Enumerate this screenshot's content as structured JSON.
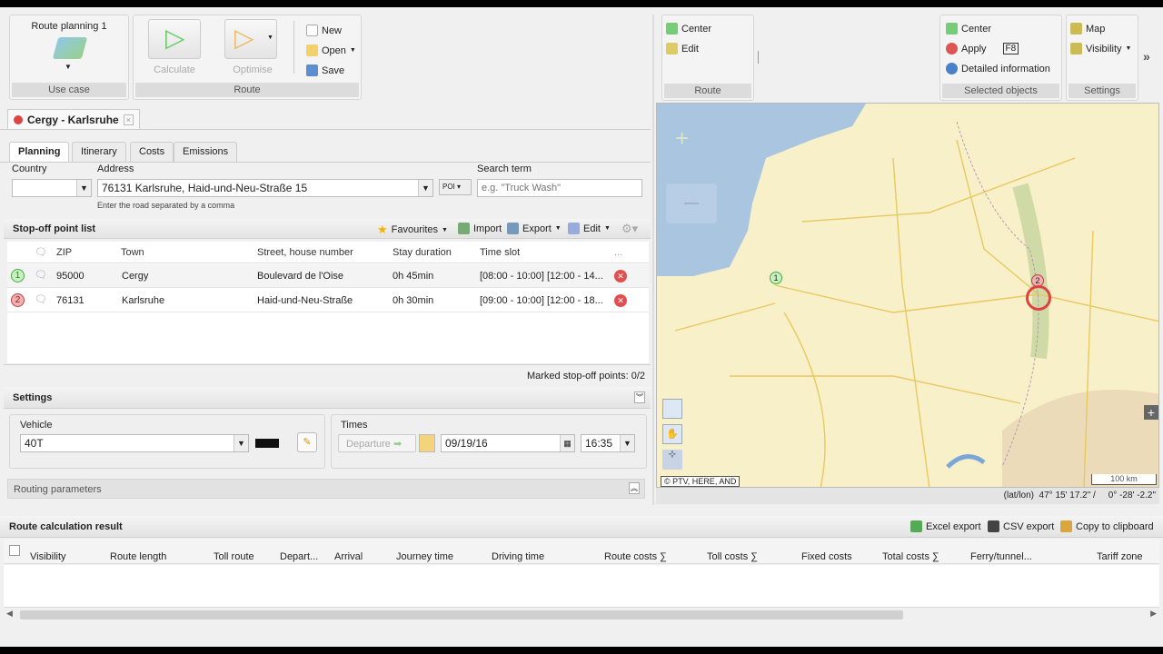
{
  "ribbon": {
    "use_case": {
      "title": "Route planning 1",
      "caption": "Use case"
    },
    "route": {
      "calculate": "Calculate",
      "optimise": "Optimise",
      "new": "New",
      "open": "Open",
      "save": "Save",
      "caption": "Route"
    },
    "map_route": {
      "center": "Center",
      "edit": "Edit",
      "caption": "Route"
    },
    "selected": {
      "center": "Center",
      "apply": "Apply",
      "shortcut": "F8",
      "details": "Detailed information",
      "caption": "Selected objects"
    },
    "settings": {
      "map": "Map",
      "visibility": "Visibility",
      "caption": "Settings",
      "more": "»"
    }
  },
  "doc_tab": {
    "title": "Cergy - Karlsruhe"
  },
  "tabs": [
    {
      "label": "Planning",
      "active": true
    },
    {
      "label": "Itinerary"
    },
    {
      "label": "Costs"
    },
    {
      "label": "Emissions"
    }
  ],
  "address_form": {
    "country_label": "Country",
    "country_value": "",
    "address_label": "Address",
    "address_value": "76131 Karlsruhe, Haid-und-Neu-Straße 15",
    "hint": "Enter the road separated by a comma",
    "poi": "POI",
    "search_label": "Search term",
    "search_placeholder": "e.g. \"Truck Wash\""
  },
  "stoplist": {
    "title": "Stop-off point list",
    "favourites": "Favourites",
    "import": "Import",
    "export": "Export",
    "edit": "Edit",
    "columns": [
      "ZIP",
      "Town",
      "Street, house number",
      "Stay duration",
      "Time slot",
      "..."
    ],
    "rows": [
      {
        "n": "1",
        "zip": "95000",
        "town": "Cergy",
        "street": "Boulevard de l'Oise",
        "stay": "0h 45min",
        "slot": "[08:00 - 10:00] [12:00 - 14..."
      },
      {
        "n": "2",
        "zip": "76131",
        "town": "Karlsruhe",
        "street": "Haid-und-Neu-Straße",
        "stay": "0h 30min",
        "slot": "[09:00 - 10:00] [12:00 - 18..."
      }
    ],
    "marked": "Marked stop-off points: 0/2"
  },
  "settings": {
    "title": "Settings",
    "vehicle_label": "Vehicle",
    "vehicle": "40T",
    "times_label": "Times",
    "departure": "Departure",
    "date": "09/19/16",
    "time": "16:35",
    "routing": "Routing parameters"
  },
  "map": {
    "copyright": "© PTV, HERE, AND",
    "scale": "100 km",
    "coords": "(lat/lon)  47° 15' 17.2\" /     0° -28' -2.2\"",
    "marker1": "1",
    "marker2": "2",
    "sea": "#a9c5e0",
    "land": "#f8f0c8"
  },
  "results": {
    "title": "Route calculation result",
    "excel": "Excel export",
    "csv": "CSV export",
    "clipboard": "Copy to clipboard",
    "columns": [
      "Visibility",
      "Route length",
      "Toll route",
      "Depart...",
      "Arrival",
      "Journey time",
      "Driving time",
      "Route costs ∑",
      "Toll costs ∑",
      "Fixed costs",
      "Total costs ∑",
      "Ferry/tunnel...",
      "Tariff zone"
    ]
  }
}
